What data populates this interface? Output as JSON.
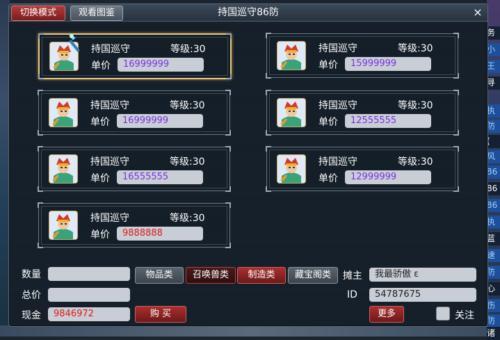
{
  "window": {
    "title": "持国巡守86防",
    "tab_switch": "切换模式",
    "tab_view": "观看图鉴",
    "close": "×"
  },
  "side": {
    "tags": [
      "务",
      "小",
      "王",
      "寻",
      "执",
      "防",
      "(",
      "风",
      "86",
      "86",
      "86",
      "执",
      "蓝",
      "速",
      "防",
      "心",
      "伤",
      "防",
      "诸"
    ]
  },
  "listing": {
    "name_key": "持国巡守",
    "price_label": "单价",
    "items": [
      {
        "name": "持国巡守",
        "level": "等级:30",
        "price_label": "单价",
        "price": "16999999",
        "selected": true
      },
      {
        "name": "持国巡守",
        "level": "等级:30",
        "price_label": "单价",
        "price": "15999999",
        "selected": false
      },
      {
        "name": "持国巡守",
        "level": "等级:30",
        "price_label": "单价",
        "price": "16999999",
        "selected": false
      },
      {
        "name": "持国巡守",
        "level": "等级:30",
        "price_label": "单价",
        "price": "12555555",
        "selected": false
      },
      {
        "name": "持国巡守",
        "level": "等级:30",
        "price_label": "单价",
        "price": "16555555",
        "selected": false
      },
      {
        "name": "持国巡守",
        "level": "等级:30",
        "price_label": "单价",
        "price": "12999999",
        "selected": false
      },
      {
        "name": "持国巡守",
        "level": "等级:30",
        "price_label": "单价",
        "price": "9888888",
        "selected": false
      }
    ]
  },
  "controls": {
    "quantity_label": "数量",
    "quantity_value": "",
    "total_label": "总价",
    "total_value": "",
    "cash_label": "现金",
    "cash_value": "9846972",
    "buy_button": "购 买",
    "category_items": "物品类",
    "category_summon": "召唤兽类",
    "category_craft": "制造类",
    "category_treasure": "藏宝阁类",
    "owner_label": "摊主",
    "owner_value": "我最骄傲 ε",
    "id_label": "ID",
    "id_value": "54787675",
    "more_button": "更多",
    "follow_label": "关注"
  },
  "colors": {
    "price_purple": "#7a30e0",
    "price_red": "#e01818",
    "selected_border": "#e8c77a"
  }
}
